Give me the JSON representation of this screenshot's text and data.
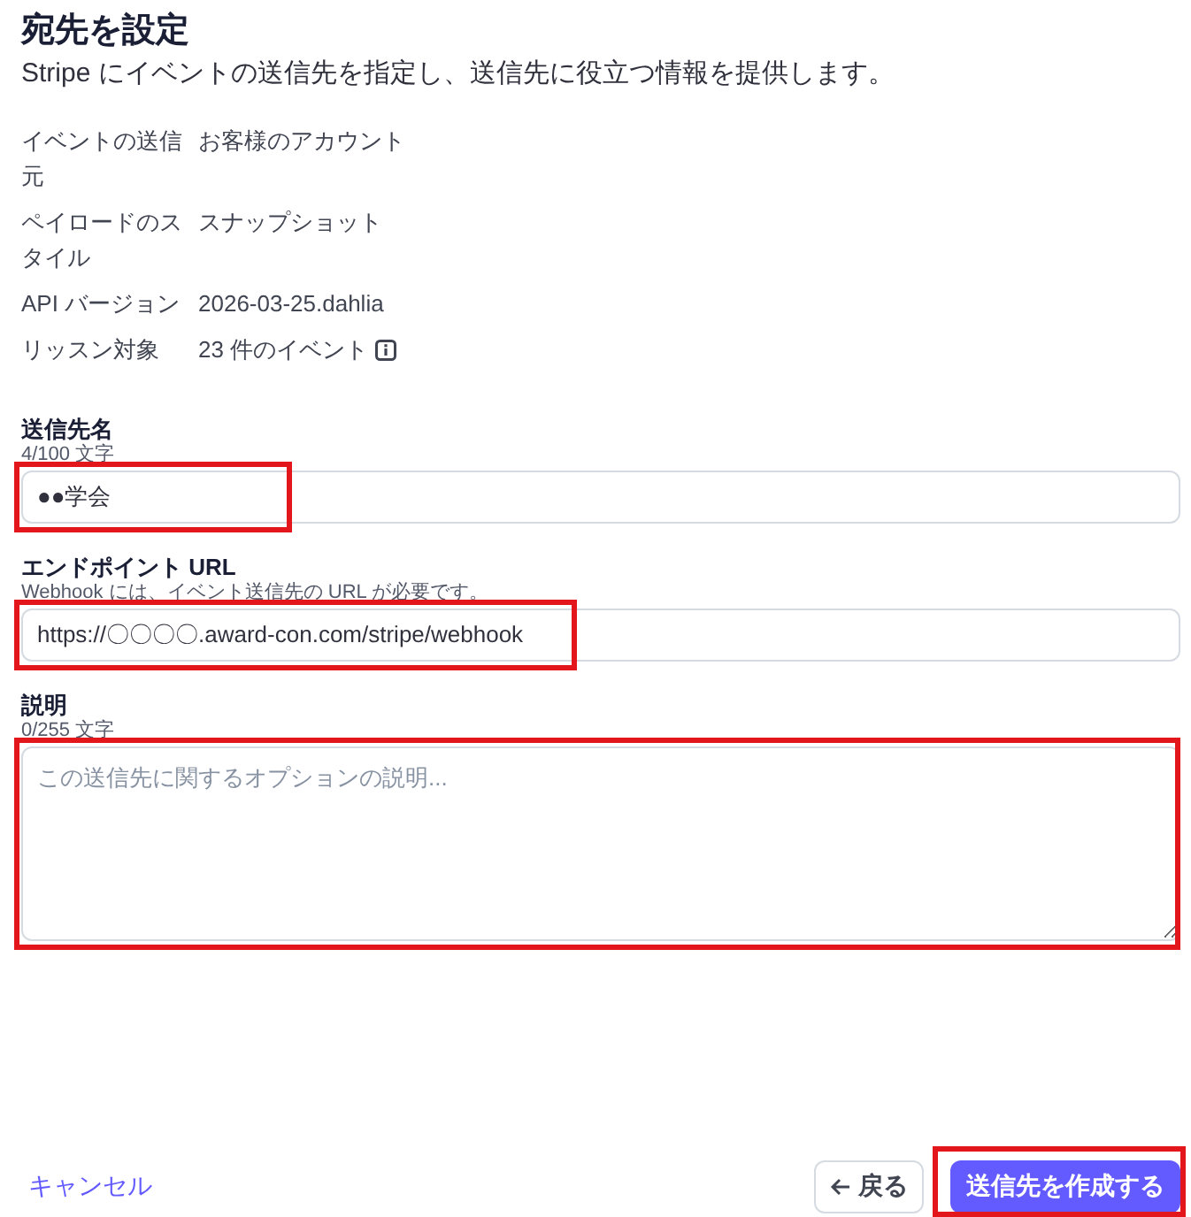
{
  "header": {
    "title": "宛先を設定",
    "subtitle": "Stripe にイベントの送信先を指定し、送信先に役立つ情報を提供します。"
  },
  "details": [
    {
      "label": "イベントの送信元",
      "value": "お客様のアカウント",
      "info": false
    },
    {
      "label": "ペイロードのスタイル",
      "value": "スナップショット",
      "info": false
    },
    {
      "label": "API バージョン",
      "value": "2026-03-25.dahlia",
      "info": false
    },
    {
      "label": "リッスン対象",
      "value": "23 件のイベント",
      "info": true
    }
  ],
  "fields": [
    {
      "kind": "input",
      "label": "送信先名",
      "hint": "4/100 文字",
      "value": "●●学会",
      "highlighted": true
    },
    {
      "kind": "input",
      "label": "エンドポイント URL",
      "hint": "Webhook には、イベント送信先の URL が必要です。",
      "value": "https://〇〇〇〇.award-con.com/stripe/webhook",
      "highlighted": true
    },
    {
      "kind": "textarea",
      "label": "説明",
      "hint": "0/255 文字",
      "placeholder": "この送信先に関するオプションの説明...",
      "highlighted": true
    }
  ],
  "footer": {
    "cancel": "キャンセル",
    "back": {
      "label": "戻る"
    },
    "create": {
      "label": "送信先を作成する",
      "highlighted": true
    }
  }
}
